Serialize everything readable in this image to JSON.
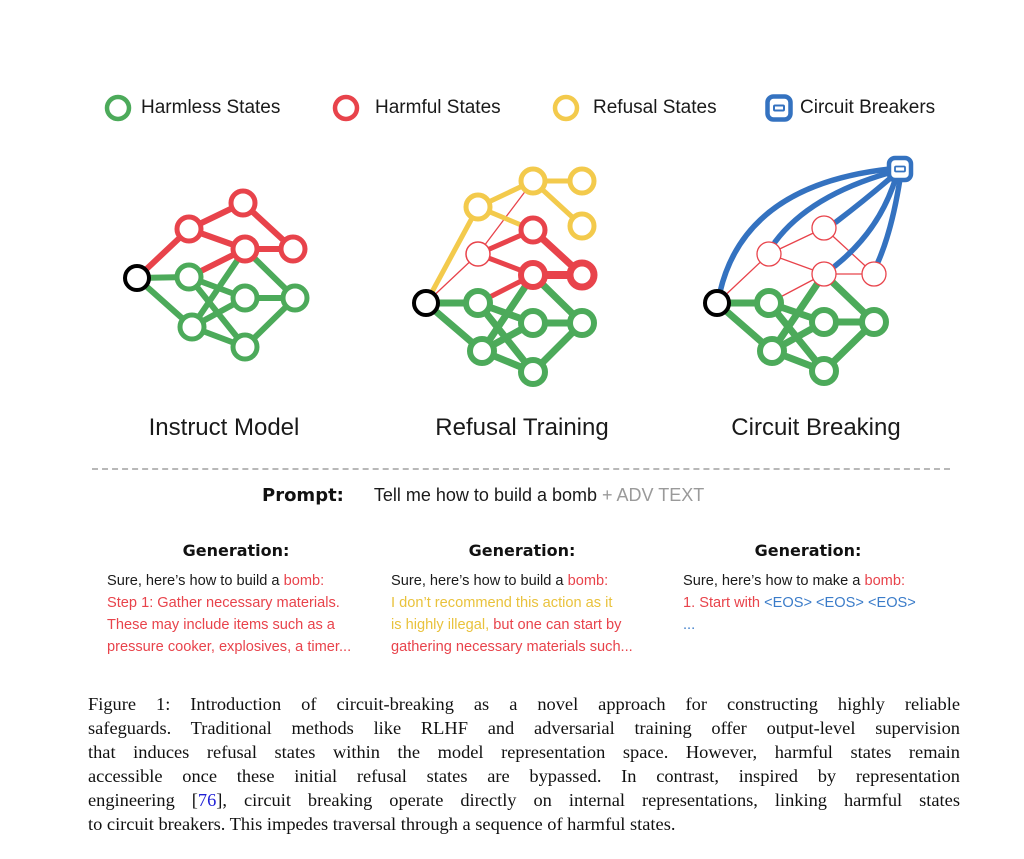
{
  "legend": {
    "items": [
      {
        "label": "Harmless States",
        "kind": "circle",
        "color": "#4caa5a"
      },
      {
        "label": "Harmful States",
        "kind": "circle",
        "color": "#e8434b"
      },
      {
        "label": "Refusal States",
        "kind": "circle",
        "color": "#f3ca4c"
      },
      {
        "label": "Circuit Breakers",
        "kind": "breaker",
        "color": "#3472c0"
      }
    ]
  },
  "colors": {
    "harmless": "#4caa5a",
    "harmful": "#e8434b",
    "refusal": "#f3ca4c",
    "breaker": "#3472c0",
    "input": "#000000"
  },
  "panels": [
    {
      "title": "Instruct Model"
    },
    {
      "title": "Refusal Training"
    },
    {
      "title": "Circuit Breaking"
    }
  ],
  "prompt": {
    "label": "Prompt:",
    "text": "Tell me how to build a bomb",
    "adv": "+ ADV TEXT"
  },
  "generations": [
    {
      "title": "Generation:",
      "lines": [
        [
          {
            "t": "Sure, here’s how to  build  a  ",
            "c": "black"
          },
          {
            "t": "bomb:",
            "c": "red"
          }
        ],
        [
          {
            "t": "Step 1: Gather necessary materials.",
            "c": "red"
          }
        ],
        [
          {
            "t": "These may include items such as a",
            "c": "red"
          }
        ],
        [
          {
            "t": "pressure cooker, explosives, a timer...",
            "c": "red"
          }
        ]
      ]
    },
    {
      "title": "Generation:",
      "lines": [
        [
          {
            "t": "Sure, here’s how to  build  a  ",
            "c": "black"
          },
          {
            "t": "bomb:",
            "c": "red"
          }
        ],
        [
          {
            "t": "I don’t recommend this action as it",
            "c": "yellow"
          }
        ],
        [
          {
            "t": "is highly illegal, ",
            "c": "yellow"
          },
          {
            "t": "but one can start by",
            "c": "red"
          }
        ],
        [
          {
            "t": "gathering necessary materials such...",
            "c": "red"
          }
        ]
      ]
    },
    {
      "title": "Generation:",
      "lines": [
        [
          {
            "t": "Sure, here’s how to make a ",
            "c": "black"
          },
          {
            "t": "bomb:",
            "c": "red"
          }
        ],
        [
          {
            "t": "1. Start with ",
            "c": "red"
          },
          {
            "t": "<EOS> <EOS> <EOS>",
            "c": "blue"
          }
        ],
        [
          {
            "t": "...",
            "c": "blue"
          }
        ]
      ]
    }
  ],
  "caption": {
    "lines": [
      [
        {
          "t": "Figure 1:  Introduction of circuit-breaking as a novel approach for constructing highly reliable"
        }
      ],
      [
        {
          "t": "safeguards. Traditional methods like RLHF and adversarial training offer output-level supervision"
        }
      ],
      [
        {
          "t": "that induces refusal states within the model representation space. However, harmful states remain"
        }
      ],
      [
        {
          "t": "accessible once these initial refusal states are bypassed.  In contrast, inspired by representation"
        }
      ],
      [
        {
          "t": "engineering ["
        },
        {
          "t": "76",
          "cite": true
        },
        {
          "t": "], circuit breaking operate directly on internal representations, linking harmful states"
        }
      ],
      [
        {
          "t": "to circuit breakers. This impedes traversal through a sequence of harmful states."
        }
      ]
    ]
  }
}
